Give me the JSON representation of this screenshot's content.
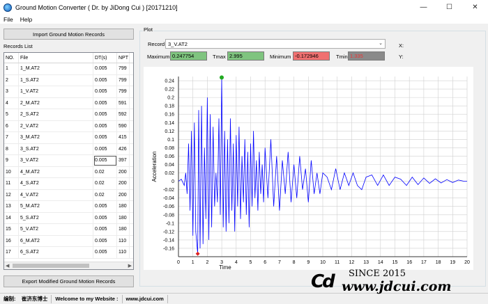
{
  "window": {
    "title": "Ground Motion Converter ( Dr. by JiDong Cui ) [20171210]",
    "min": "—",
    "max": "☐",
    "close": "✕"
  },
  "menu": {
    "file": "File",
    "help": "Help"
  },
  "left": {
    "import_label": "Import Ground Motion Records",
    "records_label": "Records List",
    "export_label": "Export Modified Ground Motion Records",
    "columns": [
      "NO.",
      "File",
      "DT(s)",
      "NPT"
    ],
    "rows": [
      [
        "1",
        "1_M.AT2",
        "0.005",
        "799"
      ],
      [
        "2",
        "1_S.AT2",
        "0.005",
        "799"
      ],
      [
        "3",
        "1_V.AT2",
        "0.005",
        "799"
      ],
      [
        "4",
        "2_M.AT2",
        "0.005",
        "591"
      ],
      [
        "5",
        "2_S.AT2",
        "0.005",
        "592"
      ],
      [
        "6",
        "2_V.AT2",
        "0.005",
        "590"
      ],
      [
        "7",
        "3_M.AT2",
        "0.005",
        "415"
      ],
      [
        "8",
        "3_S.AT2",
        "0.005",
        "426"
      ],
      [
        "9",
        "3_V.AT2",
        "0.005",
        "397"
      ],
      [
        "10",
        "4_M.AT2",
        "0.02",
        "200"
      ],
      [
        "11",
        "4_S.AT2",
        "0.02",
        "200"
      ],
      [
        "12",
        "4_V.AT2",
        "0.02",
        "200"
      ],
      [
        "13",
        "5_M.AT2",
        "0.005",
        "180"
      ],
      [
        "14",
        "5_S.AT2",
        "0.005",
        "180"
      ],
      [
        "15",
        "5_V.AT2",
        "0.005",
        "180"
      ],
      [
        "16",
        "6_M.AT2",
        "0.005",
        "110"
      ],
      [
        "17",
        "6_S.AT2",
        "0.005",
        "110"
      ]
    ]
  },
  "plot": {
    "group_label": "Plot",
    "record_label": "Record",
    "record_value": "3_V.AT2",
    "maximum_label": "Maximum",
    "maximum_value": "0.247754",
    "tmax_label": "Tmax",
    "tmax_value": "2.995",
    "minimum_label": "Minimum",
    "minimum_value": "-0.172946",
    "tmin_label": "Tmin",
    "tmin_value": "1.335",
    "x_label": "X:",
    "y_label": "Y:"
  },
  "status": {
    "author_label": "编制:",
    "author": "崔济东博士",
    "welcome": "Welcome to my Website :",
    "site": "www.jdcui.com"
  },
  "watermark": {
    "logo": "Cd",
    "since": "SINCE 2015",
    "url": "www.jdcui.com"
  },
  "colors": {
    "series": "#0000ff",
    "max_marker": "#22aa22",
    "min_marker": "#dd2222",
    "max_box": "#7fc47f",
    "min_box": "#f07070"
  },
  "chart_data": {
    "type": "line",
    "xlabel": "Time",
    "ylabel": "Acceleration",
    "xlim": [
      0,
      20
    ],
    "ylim": [
      -0.18,
      0.25
    ],
    "xticks": [
      0,
      1,
      2,
      3,
      4,
      5,
      6,
      7,
      8,
      9,
      10,
      11,
      12,
      13,
      14,
      15,
      16,
      17,
      18,
      19,
      20
    ],
    "yticks": [
      0.24,
      0.22,
      0.2,
      0.18,
      0.16,
      0.14,
      0.12,
      0.1,
      0.08,
      0.06,
      0.04,
      0.02,
      0,
      -0.02,
      -0.04,
      -0.06,
      -0.08,
      -0.1,
      -0.12,
      -0.14,
      -0.16
    ],
    "grid": true,
    "max_point": {
      "x": 2.995,
      "y": 0.247754
    },
    "min_point": {
      "x": 1.335,
      "y": -0.172946
    },
    "series": [
      {
        "x": [
          0.0,
          0.2,
          0.4,
          0.5,
          0.6,
          0.7,
          0.8,
          0.9,
          1.0,
          1.1,
          1.2,
          1.335,
          1.4,
          1.5,
          1.6,
          1.7,
          1.8,
          1.9,
          2.0,
          2.1,
          2.2,
          2.3,
          2.4,
          2.5,
          2.6,
          2.7,
          2.8,
          2.9,
          2.995,
          3.1,
          3.2,
          3.3,
          3.4,
          3.5,
          3.6,
          3.7,
          3.8,
          3.9,
          4.0,
          4.1,
          4.2,
          4.3,
          4.4,
          4.5,
          4.6,
          4.7,
          4.8,
          4.9,
          5.0,
          5.1,
          5.2,
          5.3,
          5.4,
          5.5,
          5.6,
          5.7,
          5.8,
          5.9,
          6.0,
          6.2,
          6.4,
          6.6,
          6.8,
          7.0,
          7.2,
          7.4,
          7.6,
          7.8,
          8.0,
          8.2,
          8.4,
          8.6,
          8.8,
          9.0,
          9.2,
          9.4,
          9.6,
          9.8,
          10.0,
          10.3,
          10.6,
          10.9,
          11.2,
          11.5,
          11.8,
          12.1,
          12.4,
          12.7,
          13.0,
          13.4,
          13.8,
          14.2,
          14.6,
          15.0,
          15.4,
          15.8,
          16.2,
          16.6,
          17.0,
          17.4,
          17.8,
          18.2,
          18.6,
          19.0,
          19.4,
          19.8,
          20.0
        ],
        "y": [
          0,
          0.005,
          -0.01,
          0.02,
          -0.03,
          0.09,
          -0.07,
          0.12,
          -0.13,
          0.14,
          -0.12,
          -0.173,
          0.17,
          -0.16,
          0.18,
          -0.15,
          0.08,
          -0.09,
          0.2,
          -0.14,
          0.16,
          -0.11,
          0.13,
          -0.06,
          0.02,
          -0.05,
          0.15,
          -0.08,
          0.248,
          -0.11,
          0.12,
          -0.12,
          0.1,
          -0.1,
          0.15,
          -0.07,
          0.09,
          -0.12,
          0.11,
          -0.06,
          0.13,
          -0.09,
          0.06,
          -0.05,
          0.1,
          -0.08,
          0.07,
          -0.11,
          0.09,
          -0.06,
          0.12,
          -0.04,
          0.05,
          -0.07,
          0.07,
          -0.03,
          0.04,
          -0.05,
          0.08,
          -0.04,
          0.1,
          -0.06,
          0.06,
          -0.07,
          0.05,
          -0.03,
          0.07,
          -0.05,
          0.04,
          -0.04,
          0.06,
          -0.02,
          0.03,
          -0.05,
          0.05,
          -0.03,
          0.02,
          -0.03,
          0.02,
          0.01,
          -0.02,
          0.03,
          -0.02,
          0.02,
          -0.01,
          0.02,
          -0.01,
          -0.02,
          0.01,
          0.015,
          -0.01,
          0.015,
          -0.01,
          0.01,
          0.005,
          -0.01,
          0.01,
          -0.008,
          0.008,
          -0.005,
          0.006,
          -0.004,
          0.004,
          -0.003,
          0.003,
          0.0,
          0.0
        ]
      }
    ]
  }
}
